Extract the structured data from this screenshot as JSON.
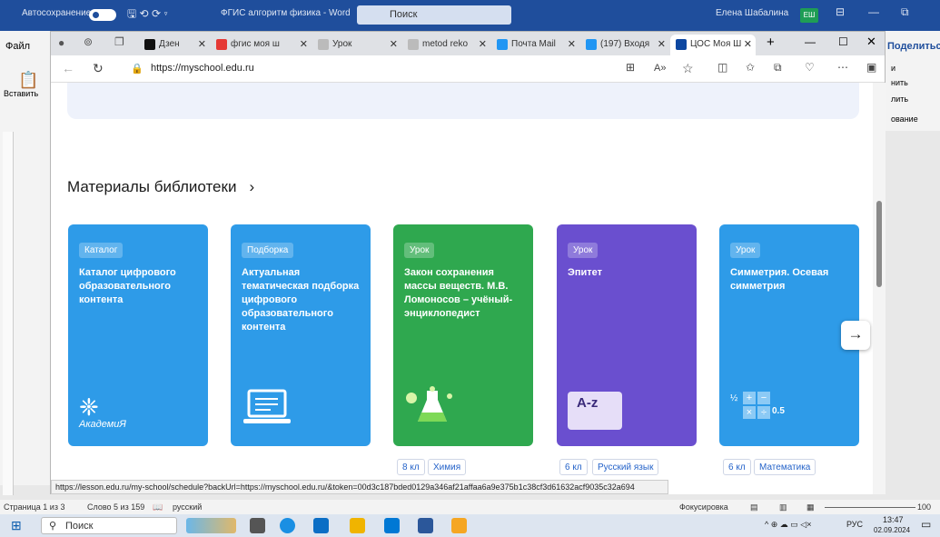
{
  "word": {
    "autosave_label": "Автосохранение",
    "title": "ФГИС алгоритм физика - Word",
    "search_placeholder": "Поиск",
    "user_name": "Елена Шабалина",
    "user_initials": "ЕШ",
    "file_tab": "Файл",
    "paste_label": "Вставить",
    "share_label": "Поделиться",
    "ribbon_right": [
      "и",
      "нить",
      "лить",
      "ование"
    ],
    "status": {
      "page": "Страница 1 из 3",
      "words": "Слово 5 из 159",
      "language": "русский",
      "focus": "Фокусировка",
      "zoom": "100"
    }
  },
  "browser": {
    "tabs": [
      {
        "label": "Дзен",
        "color": "#111111"
      },
      {
        "label": "фгис моя ш",
        "color": "#e53935"
      },
      {
        "label": "Урок",
        "color": "#9e9e9e"
      },
      {
        "label": "metod reko",
        "color": "#9e9e9e"
      },
      {
        "label": "Почта Mail",
        "color": "#2196f3"
      },
      {
        "label": "(197) Входя",
        "color": "#2196f3"
      },
      {
        "label": "ЦОС Моя Ш",
        "color": "#0d47a1"
      }
    ],
    "url": "https://myschool.edu.ru",
    "status_url": "https://lesson.edu.ru/my-school/schedule?backUrl=https://myschool.edu.ru/&token=00d3c187bded0129a346af21affaa6a9e375b1c38cf3d61632acf9035c32a694"
  },
  "library": {
    "title": "Материалы библиотеки",
    "cards": [
      {
        "badge": "Каталог",
        "title": "Каталог цифрового образовательного контента",
        "color": "#2e9be8",
        "icon": "academy-logo-icon",
        "icon_text": "АкадемиЯ",
        "tags": []
      },
      {
        "badge": "Подборка",
        "title": "Актуальная тематическая подборка цифрового образовательного контента",
        "color": "#2e9be8",
        "icon": "laptop-icon",
        "tags": []
      },
      {
        "badge": "Урок",
        "title": "Закон сохранения массы веществ. М.В. Ломоносов – учёный-энциклопедист",
        "color": "#2fa84f",
        "icon": "flask-icon",
        "tags": [
          "8 кл",
          "Химия"
        ]
      },
      {
        "badge": "Урок",
        "title": "Эпитет",
        "color": "#6a4fcf",
        "icon": "dictionary-icon",
        "icon_text": "A-z",
        "tags": [
          "6 кл",
          "Русский язык"
        ]
      },
      {
        "badge": "Урок",
        "title": "Симметрия. Осевая симметрия",
        "color": "#2e9be8",
        "icon": "calculator-icon",
        "icon_text": "0.5",
        "tags": [
          "6 кл",
          "Математика"
        ]
      }
    ]
  },
  "taskbar": {
    "search_placeholder": "Поиск",
    "language": "РУС",
    "time": "13:47",
    "date": "02.09.2024"
  }
}
